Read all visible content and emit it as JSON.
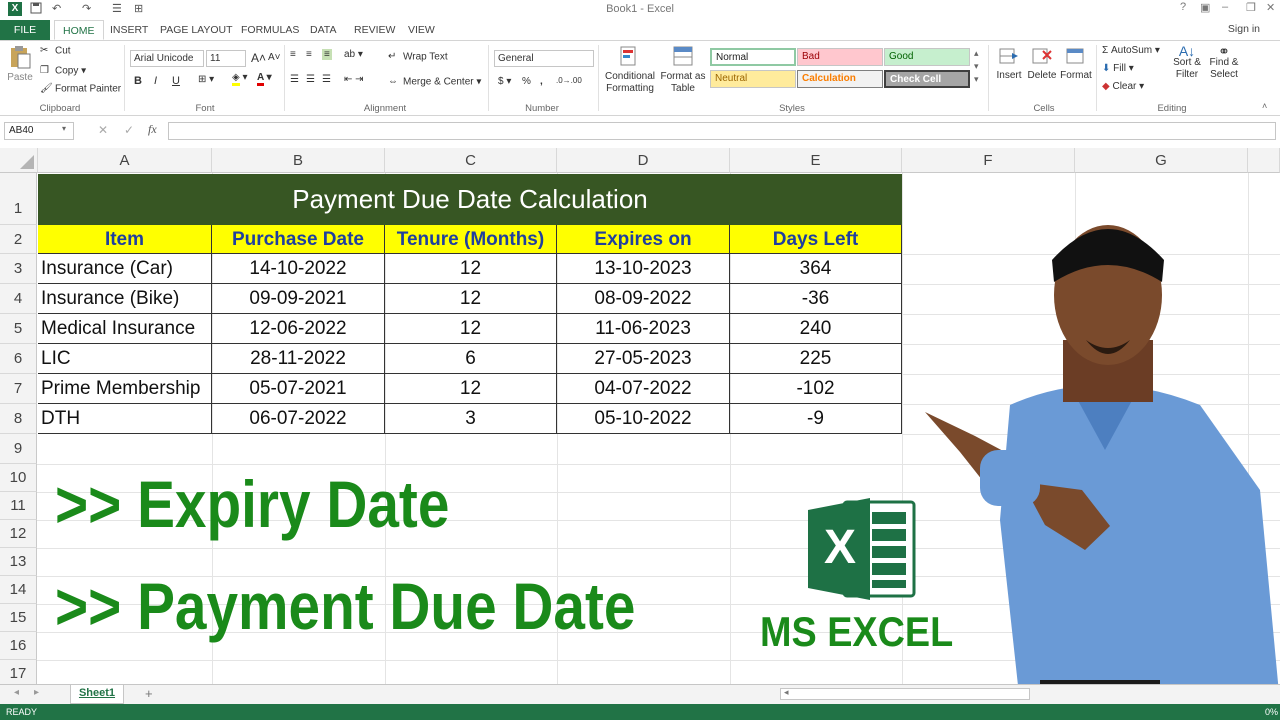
{
  "window": {
    "title": "Book1 - Excel",
    "app_icon": "X"
  },
  "ribbon_tabs": [
    "FILE",
    "HOME",
    "INSERT",
    "PAGE LAYOUT",
    "FORMULAS",
    "DATA",
    "REVIEW",
    "VIEW"
  ],
  "sign_in": "Sign in",
  "clipboard": {
    "paste": "Paste",
    "cut": "Cut",
    "copy": "Copy",
    "format_painter": "Format Painter",
    "label": "Clipboard"
  },
  "font": {
    "name": "Arial Unicode",
    "size": "11",
    "grow": "A",
    "shrink": "A",
    "bold": "B",
    "italic": "I",
    "underline": "U",
    "label": "Font"
  },
  "alignment": {
    "wrap_text": "Wrap Text",
    "merge_center": "Merge & Center",
    "label": "Alignment"
  },
  "number": {
    "format": "General",
    "currency": "$",
    "percent": "%",
    "comma": ",",
    "label": "Number"
  },
  "styles_group": {
    "conditional_formatting": [
      "Conditional",
      "Formatting"
    ],
    "format_as_table": [
      "Format as",
      "Table"
    ],
    "cells": [
      "Normal",
      "Bad",
      "Good",
      "Neutral",
      "Calculation",
      "Check Cell"
    ],
    "label": "Styles"
  },
  "cells_group": {
    "insert": "Insert",
    "delete": "Delete",
    "format": "Format",
    "label": "Cells"
  },
  "editing": {
    "autosum": "AutoSum",
    "fill": "Fill",
    "clear": "Clear",
    "sort_filter": [
      "Sort &",
      "Filter"
    ],
    "find_select": [
      "Find &",
      "Select"
    ],
    "label": "Editing"
  },
  "formula_bar": {
    "name_box": "AB40",
    "fx": "fx",
    "cancel": "✕",
    "enter": "✓",
    "value": ""
  },
  "columns": [
    "A",
    "B",
    "C",
    "D",
    "E",
    "F",
    "G"
  ],
  "rows": [
    "1",
    "2",
    "3",
    "4",
    "5",
    "6",
    "7",
    "8",
    "9",
    "10",
    "11",
    "12",
    "13",
    "14",
    "15",
    "16",
    "17"
  ],
  "table": {
    "title": "Payment Due Date Calculation",
    "headers": [
      "Item",
      "Purchase Date",
      "Tenure (Months)",
      "Expires on",
      "Days Left"
    ],
    "rows": [
      [
        "Insurance (Car)",
        "14-10-2022",
        "12",
        "13-10-2023",
        "364"
      ],
      [
        "Insurance (Bike)",
        "09-09-2021",
        "12",
        "08-09-2022",
        "-36"
      ],
      [
        "Medical Insurance",
        "12-06-2022",
        "12",
        "11-06-2023",
        "240"
      ],
      [
        "LIC",
        "28-11-2022",
        "6",
        "27-05-2023",
        "225"
      ],
      [
        "Prime Membership",
        "05-07-2021",
        "12",
        "04-07-2022",
        "-102"
      ],
      [
        "DTH",
        "06-07-2022",
        "3",
        "05-10-2022",
        "-9"
      ]
    ],
    "title_bg": "#375623",
    "header_bg": "#ffff00",
    "header_text": "#1f3f9f"
  },
  "overlay": {
    "line1": ">> Expiry Date",
    "line2": ">> Payment Due Date",
    "logo_label": "MS EXCEL",
    "logo_letter": "X",
    "accent": "#1a8a1a"
  },
  "sheet_tabs": [
    "Sheet1"
  ],
  "add_sheet": "+",
  "status": {
    "text": "READY",
    "zoom": "0%"
  }
}
